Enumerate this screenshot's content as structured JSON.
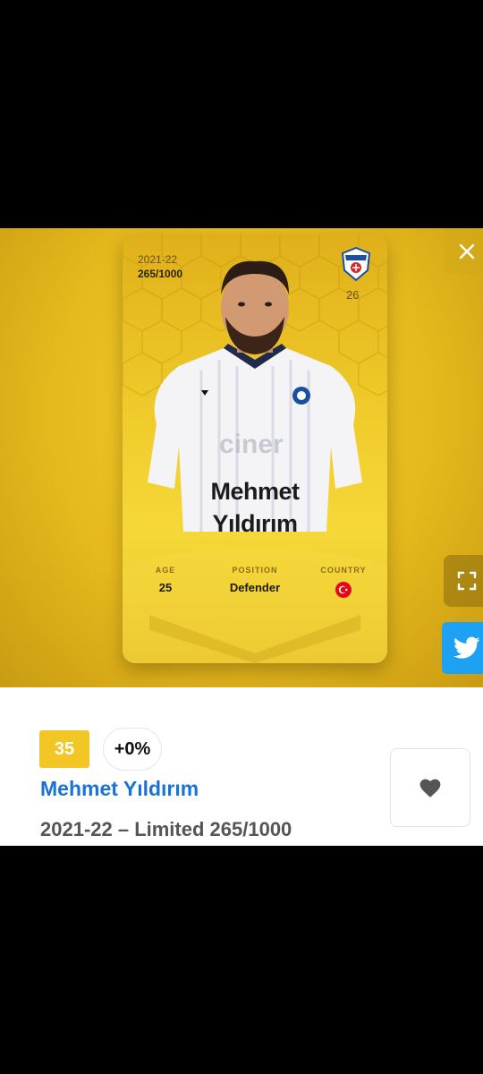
{
  "card": {
    "season": "2021-22",
    "serial": "265/1000",
    "shirt_number": "26",
    "first_name": "Mehmet",
    "last_name": "Yıldırım",
    "stats": {
      "age_label": "AGE",
      "age_value": "25",
      "position_label": "POSITION",
      "position_value": "Defender",
      "country_label": "COUNTRY"
    },
    "sponsor_text": "ciner",
    "rarity_color": "#f2c624"
  },
  "actions": {
    "close_icon": "close-icon",
    "expand_icon": "expand-icon",
    "twitter_icon": "twitter-icon"
  },
  "details": {
    "score": "35",
    "score_change": "+0%",
    "player_name": "Mehmet Yıldırım",
    "description": "2021-22 – Limited 265/1000",
    "favorite_icon": "heart-icon"
  },
  "colors": {
    "accent": "#1773d7",
    "twitter": "#1da1f2",
    "limited_yellow": "#f2c624"
  }
}
